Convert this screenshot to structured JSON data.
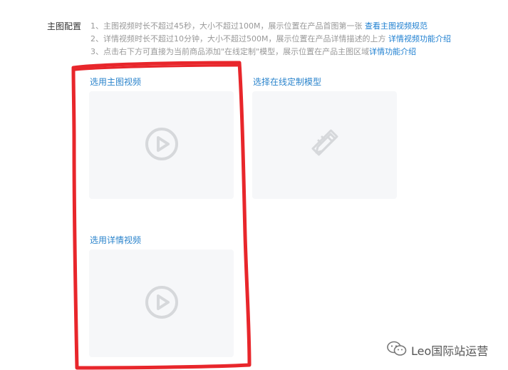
{
  "section": {
    "label": "主图配置"
  },
  "instructions": {
    "line1_text": "1、主图视频时长不超过45秒，大小不超过100M，展示位置在产品首图第一张 ",
    "line1_link": "查看主图视频规范",
    "line2_text": "2、详情视频时长不超过10分钟，大小不超过500M，展示位置在产品详情描述的上方 ",
    "line2_link": "详情视频功能介绍",
    "line3_text": "3、点击右下方可直接为当前商品添加\"在线定制\"模型，展示位置在产品主图区域",
    "line3_link": "详情功能介绍"
  },
  "slots": {
    "main_video": {
      "title": "选用主图视频",
      "icon": "play-circle-icon"
    },
    "custom_model": {
      "title": "选择在线定制模型",
      "icon": "pencil-ruler-icon"
    },
    "detail_video": {
      "title": "选用详情视频",
      "icon": "play-circle-icon"
    }
  },
  "watermark": {
    "text": "Leo国际站运营",
    "icon": "wechat-icon"
  },
  "colors": {
    "link": "#1e7fd0",
    "highlight": "#e8262b",
    "placeholder_bg": "#f6f7f9",
    "icon_gray": "#d6d8db"
  }
}
